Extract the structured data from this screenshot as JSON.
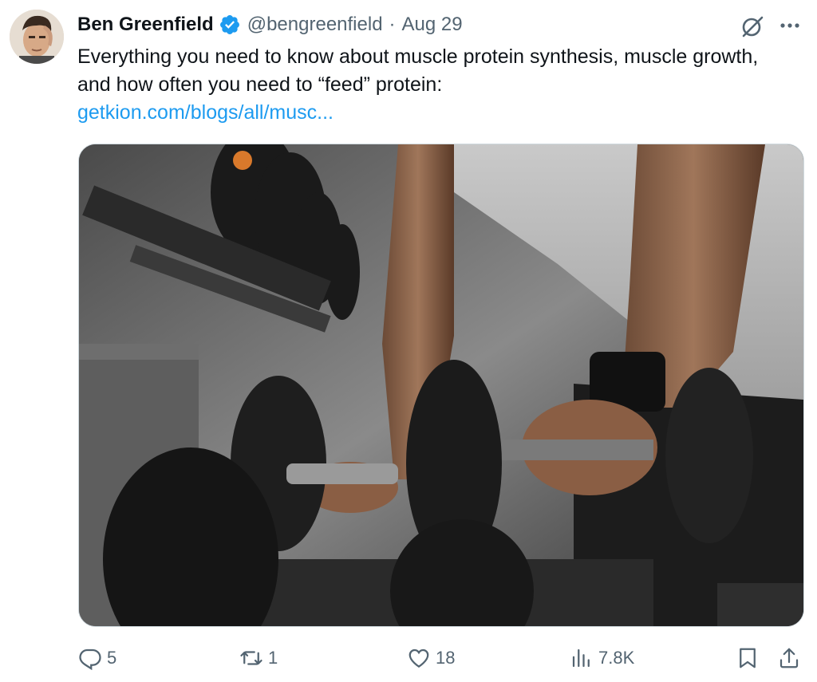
{
  "tweet": {
    "author_name": "Ben Greenfield",
    "handle": "@bengreenfield",
    "separator": "·",
    "date": "Aug 29",
    "text": "Everything you need to know about muscle protein synthesis, muscle growth, and how often you need to “feed” protein:",
    "link_text": "getkion.com/blogs/all/musc..."
  },
  "actions": {
    "replies": "5",
    "reposts": "1",
    "likes": "18",
    "views": "7.8K"
  },
  "colors": {
    "link": "#1d9bf0",
    "verified_badge": "#1d9bf0",
    "secondary_text": "#536471"
  },
  "icons": {
    "verified": "verified-badge-icon",
    "grok": "grok-icon",
    "more": "more-dots-icon",
    "reply": "reply-icon",
    "repost": "repost-icon",
    "like": "heart-icon",
    "views": "views-chart-icon",
    "bookmark": "bookmark-icon",
    "share": "share-icon"
  }
}
